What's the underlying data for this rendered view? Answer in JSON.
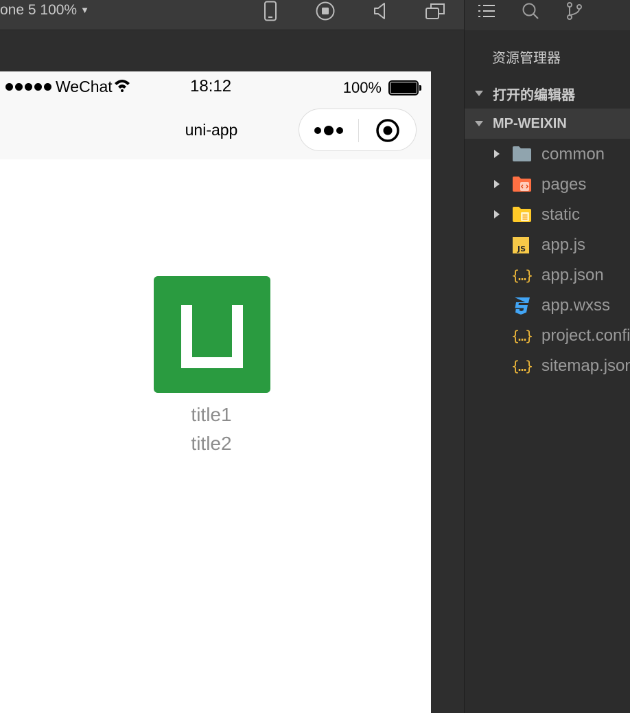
{
  "toolbar": {
    "device_label": "one 5 100%",
    "icons": [
      "phone-icon",
      "record-icon",
      "sound-icon",
      "window-icon"
    ]
  },
  "phone": {
    "status_bar": {
      "carrier": "WeChat",
      "time": "18:12",
      "battery": "100%",
      "battery_level": 100
    },
    "nav": {
      "title": "uni-app"
    },
    "content": {
      "logo_color": "#2a9b40",
      "title1": "title1",
      "title2": "title2"
    }
  },
  "explorer": {
    "activity_icons": [
      "list-icon",
      "search-icon",
      "source-control-icon"
    ],
    "heading": "资源管理器",
    "open_editors_label": "打开的编辑器",
    "project_label": "MP-WEIXIN",
    "files": [
      {
        "name": "common",
        "type": "folder",
        "icon": "folder-icon"
      },
      {
        "name": "pages",
        "type": "folder",
        "icon": "pages-folder-icon"
      },
      {
        "name": "static",
        "type": "folder",
        "icon": "static-folder-icon"
      },
      {
        "name": "app.js",
        "type": "file",
        "icon": "js-file-icon"
      },
      {
        "name": "app.json",
        "type": "file",
        "icon": "json-file-icon"
      },
      {
        "name": "app.wxss",
        "type": "file",
        "icon": "css-file-icon"
      },
      {
        "name": "project.config.json",
        "type": "file",
        "icon": "json-file-icon"
      },
      {
        "name": "sitemap.json",
        "type": "file",
        "icon": "json-file-icon"
      }
    ]
  },
  "colors": {
    "folder_blue": "#90a4ae",
    "pages_orange": "#ff7043",
    "static_yellow": "#ffca28",
    "js_yellow": "#f7c948",
    "json_yellow": "#f0b93a",
    "css_blue": "#42a5f5"
  }
}
